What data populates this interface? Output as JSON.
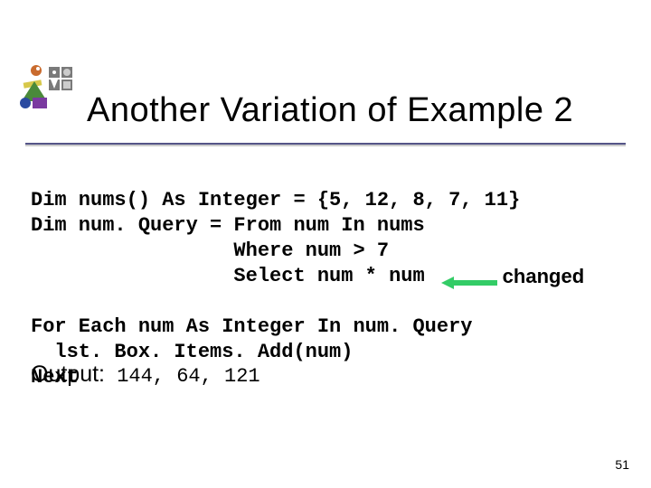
{
  "title": "Another Variation of Example 2",
  "code": {
    "line1": "Dim nums() As Integer = {5, 12, 8, 7, 11}",
    "line2": "Dim num. Query = From num In nums",
    "line3": "                 Where num > 7",
    "line4": "                 Select num * num",
    "line5": "For Each num As Integer In num. Query",
    "line6": "  lst. Box. Items. Add(num)",
    "line7": "Next"
  },
  "annotation": "changed",
  "output_label": "Output:",
  "output_values": " 144, 64, 121",
  "page_number": "51",
  "colors": {
    "arrow": "#33cc66",
    "rule": "#555588"
  }
}
